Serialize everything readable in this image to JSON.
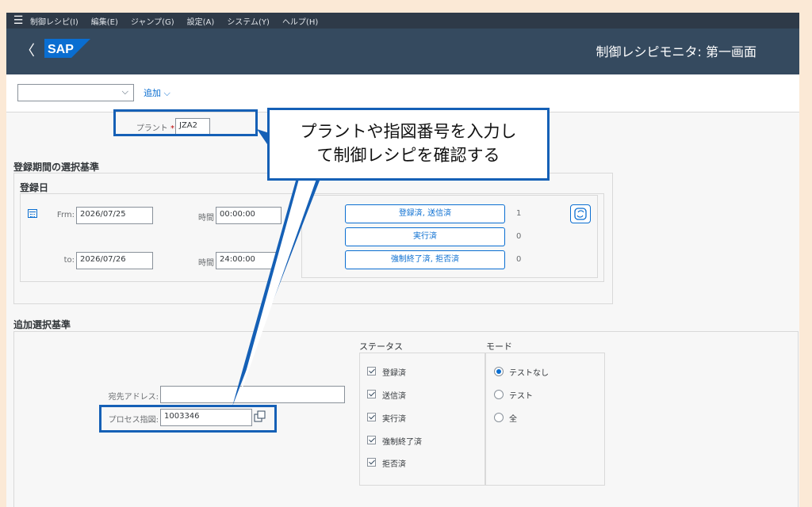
{
  "menu": {
    "items": [
      "制御レシピ(I)",
      "編集(E)",
      "ジャンプ(G)",
      "設定(A)",
      "システム(Y)",
      "ヘルプ(H)"
    ]
  },
  "title": {
    "back": "〈",
    "logo": "SAP",
    "screen_title": "制御レシピモニタ: 第一画面"
  },
  "toolbar": {
    "variant_value": "",
    "add_label": "追加 ⌵"
  },
  "plant": {
    "label": "プラント",
    "required": "*",
    "value": "JZA2"
  },
  "reg_period": {
    "section_title": "登録期間の選択基準",
    "group_title": "登録日",
    "from_label": "Frm:",
    "from_date": "2026/07/25",
    "from_time_label": "時間",
    "from_time": "00:00:00",
    "to_label": "to:",
    "to_date": "2026/07/26",
    "to_time_label": "時間",
    "to_time": "24:00:00",
    "buttons": [
      {
        "label": "登録済, 送信済",
        "count": "1"
      },
      {
        "label": "実行済",
        "count": "0"
      },
      {
        "label": "強制終了済, 拒否済",
        "count": "0"
      }
    ]
  },
  "additional": {
    "section_title": "追加選択基準",
    "dest_label": "宛先アドレス",
    "dest_value": "",
    "process_label": "プロセス指図",
    "process_value": "1003346"
  },
  "status": {
    "title": "ステータス",
    "items": [
      {
        "label": "登録済",
        "checked": true
      },
      {
        "label": "送信済",
        "checked": true
      },
      {
        "label": "実行済",
        "checked": true
      },
      {
        "label": "強制終了済",
        "checked": true
      },
      {
        "label": "拒否済",
        "checked": true
      }
    ]
  },
  "mode": {
    "title": "モード",
    "items": [
      {
        "label": "テストなし",
        "selected": true
      },
      {
        "label": "テスト",
        "selected": false
      },
      {
        "label": "全",
        "selected": false
      }
    ]
  },
  "callout": {
    "line1": "プラントや指図番号を入力し",
    "line2": "て制御レシピを確認する"
  },
  "colors": {
    "shell": "#354a5f",
    "menubar": "#2e3a48",
    "accent": "#0a6ed1",
    "annotation": "#1560b6",
    "page_bg": "#fbe9d6"
  }
}
